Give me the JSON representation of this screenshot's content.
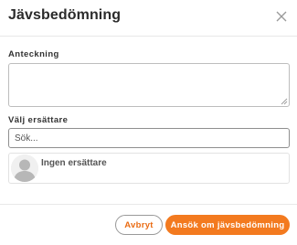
{
  "dialog": {
    "title": "Jävsbedömning",
    "close_icon": "close-icon"
  },
  "note": {
    "label": "Anteckning",
    "value": ""
  },
  "substitute": {
    "label": "Välj ersättare",
    "search_placeholder": "Sök...",
    "items": [
      {
        "label": "Ingen ersättare",
        "icon": "avatar-placeholder-icon"
      }
    ]
  },
  "footer": {
    "cancel_label": "Avbryt",
    "apply_label": "Ansök om jävsbedömning"
  },
  "colors": {
    "accent": "#f37a1f",
    "accent_text": "#ea6c14",
    "border": "#bdbdbd",
    "divider": "#e8e8e8"
  }
}
